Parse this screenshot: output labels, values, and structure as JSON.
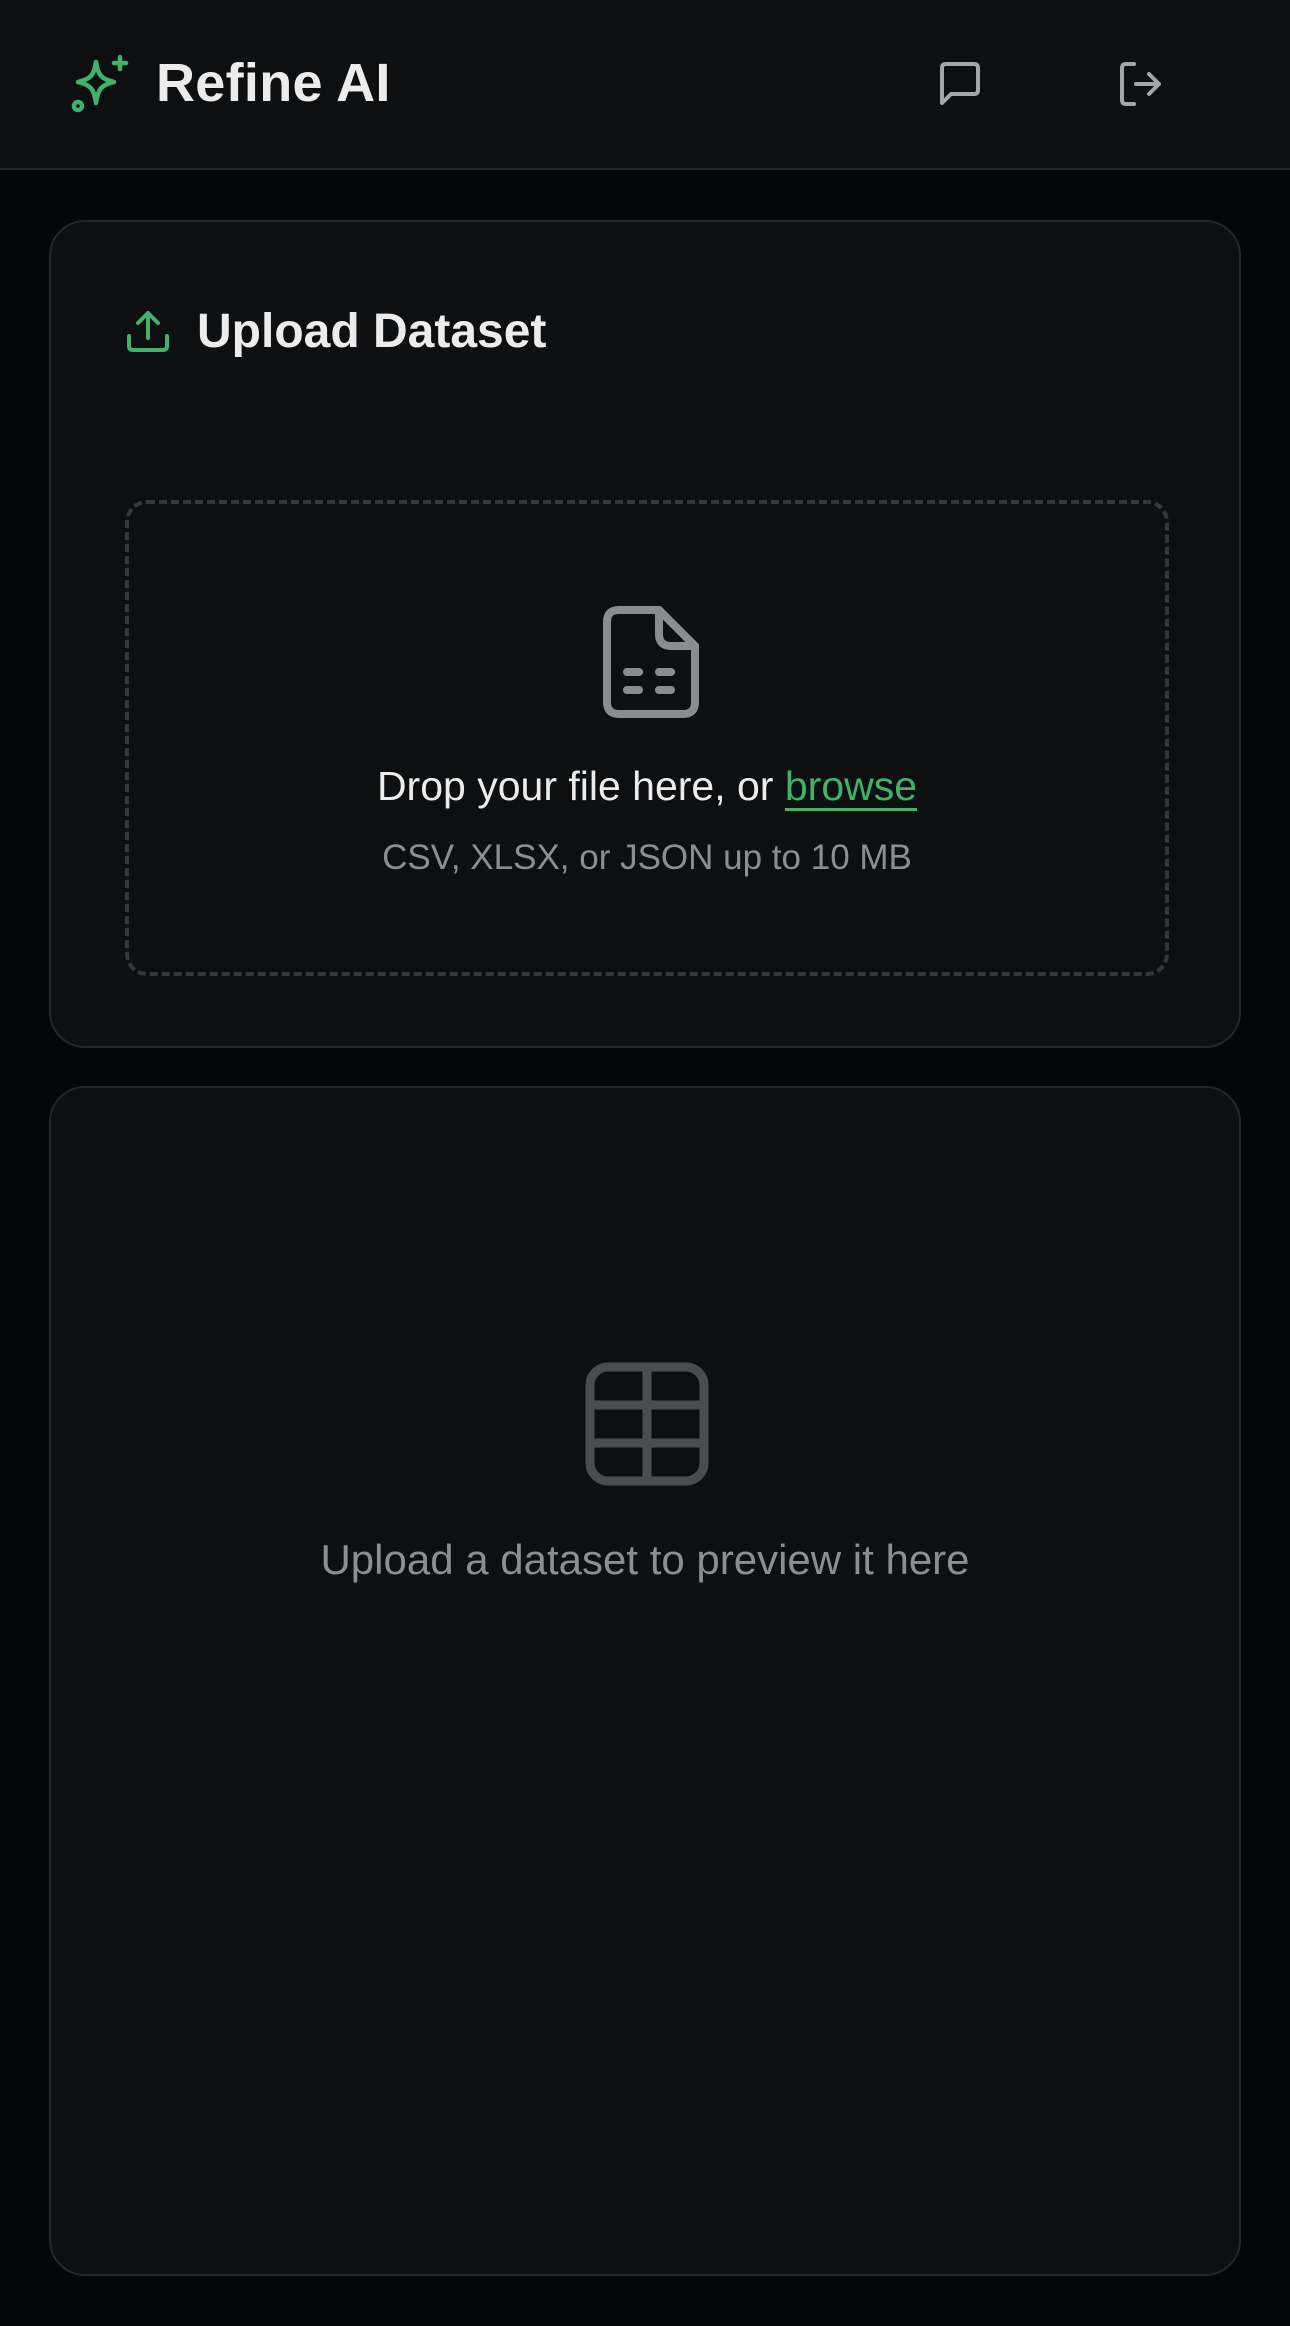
{
  "header": {
    "title": "Refine AI",
    "logo_icon": "sparkles-icon",
    "chat_icon": "message-square-icon",
    "logout_icon": "log-out-icon"
  },
  "upload_card": {
    "title": "Upload Dataset",
    "title_icon": "upload-icon",
    "dropzone": {
      "icon": "file-spreadsheet-icon",
      "prompt": "Drop your file here, or ",
      "browse_label": "browse",
      "hint": "CSV, XLSX, or JSON up to 10 MB"
    }
  },
  "preview_card": {
    "icon": "table-icon",
    "empty_text": "Upload a dataset to preview it here"
  },
  "colors": {
    "accent": "#3fb36a",
    "background": "#050607",
    "surface": "#0d0f11",
    "border": "#23272b",
    "text_primary": "#ececec",
    "text_muted": "#8c8f92"
  }
}
